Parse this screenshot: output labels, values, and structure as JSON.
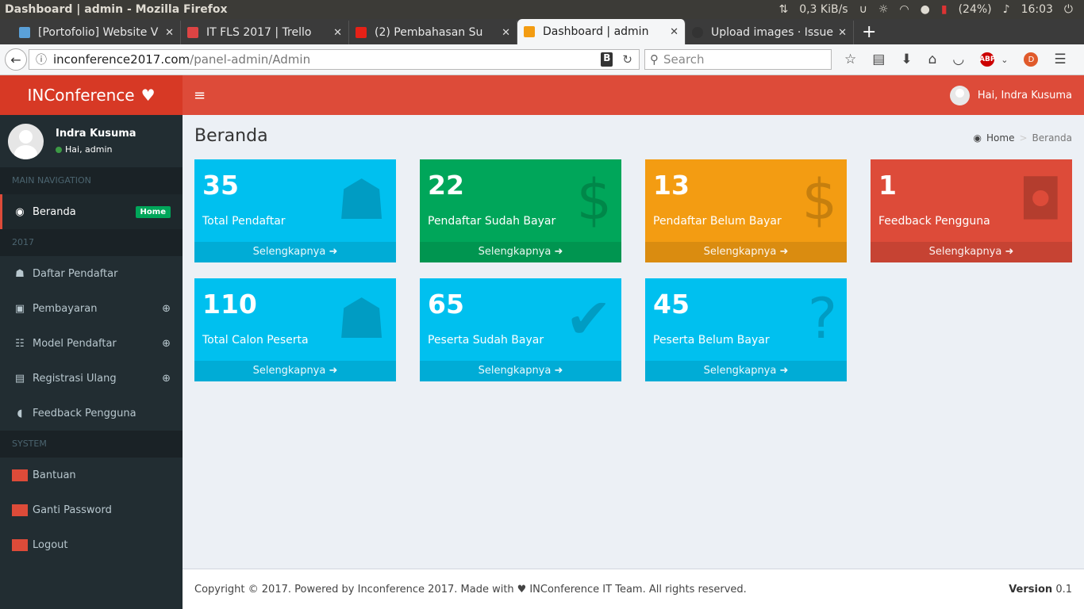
{
  "os": {
    "window_title": "Dashboard | admin - Mozilla Firefox",
    "net_speed": "0,3 KiB/s",
    "battery": "(24%)",
    "time": "16:03"
  },
  "tabs": [
    {
      "label": "[Portofolio] Website V",
      "color": "#5aa0d8"
    },
    {
      "label": "IT FLS 2017 | Trello",
      "color": "#d44"
    },
    {
      "label": "(2) Pembahasan Su",
      "color": "#e62117"
    },
    {
      "label": "Dashboard | admin",
      "color": "#f39c12"
    },
    {
      "label": "Upload images · Issue #",
      "color": "#333"
    }
  ],
  "address": {
    "host": "inconference2017.com",
    "path": "/panel-admin/Admin",
    "search_placeholder": "Search"
  },
  "app": {
    "logo": "INConference",
    "greeting": "Hai, Indra Kusuma"
  },
  "user": {
    "name": "Indra Kusuma",
    "status": "Hai, admin"
  },
  "sidebar": {
    "main_header": "MAIN NAVIGATION",
    "beranda": "Beranda",
    "beranda_badge": "Home",
    "year_header": "2017",
    "items": [
      "Daftar Pendaftar",
      "Pembayaran",
      "Model Pendaftar",
      "Registrasi Ulang",
      "Feedback Pengguna"
    ],
    "system_header": "SYSTEM",
    "system_items": [
      "Bantuan",
      "Ganti Password",
      "Logout"
    ]
  },
  "page": {
    "title": "Beranda",
    "bc_home": "Home",
    "bc_current": "Beranda"
  },
  "boxes": [
    {
      "value": "35",
      "label": "Total Pendaftar",
      "link": "Selengkapnya"
    },
    {
      "value": "22",
      "label": "Pendaftar Sudah Bayar",
      "link": "Selengkapnya"
    },
    {
      "value": "13",
      "label": "Pendaftar Belum Bayar",
      "link": "Selengkapnya"
    },
    {
      "value": "1",
      "label": "Feedback Pengguna",
      "link": "Selengkapnya"
    },
    {
      "value": "110",
      "label": "Total Calon Peserta",
      "link": "Selengkapnya"
    },
    {
      "value": "65",
      "label": "Peserta Sudah Bayar",
      "link": "Selengkapnya"
    },
    {
      "value": "45",
      "label": "Peserta Belum Bayar",
      "link": "Selengkapnya"
    }
  ],
  "footer": {
    "left_a": "Copyright © 2017. Powered by Inconference 2017. Made with",
    "left_b": "INConference IT Team. All rights reserved.",
    "version_label": "Version",
    "version": "0.1"
  },
  "colors": {
    "aqua": "#00c0ef",
    "green": "#00a65a",
    "yellow": "#f39c12",
    "red": "#dd4b39",
    "sidebar": "#222d32"
  }
}
